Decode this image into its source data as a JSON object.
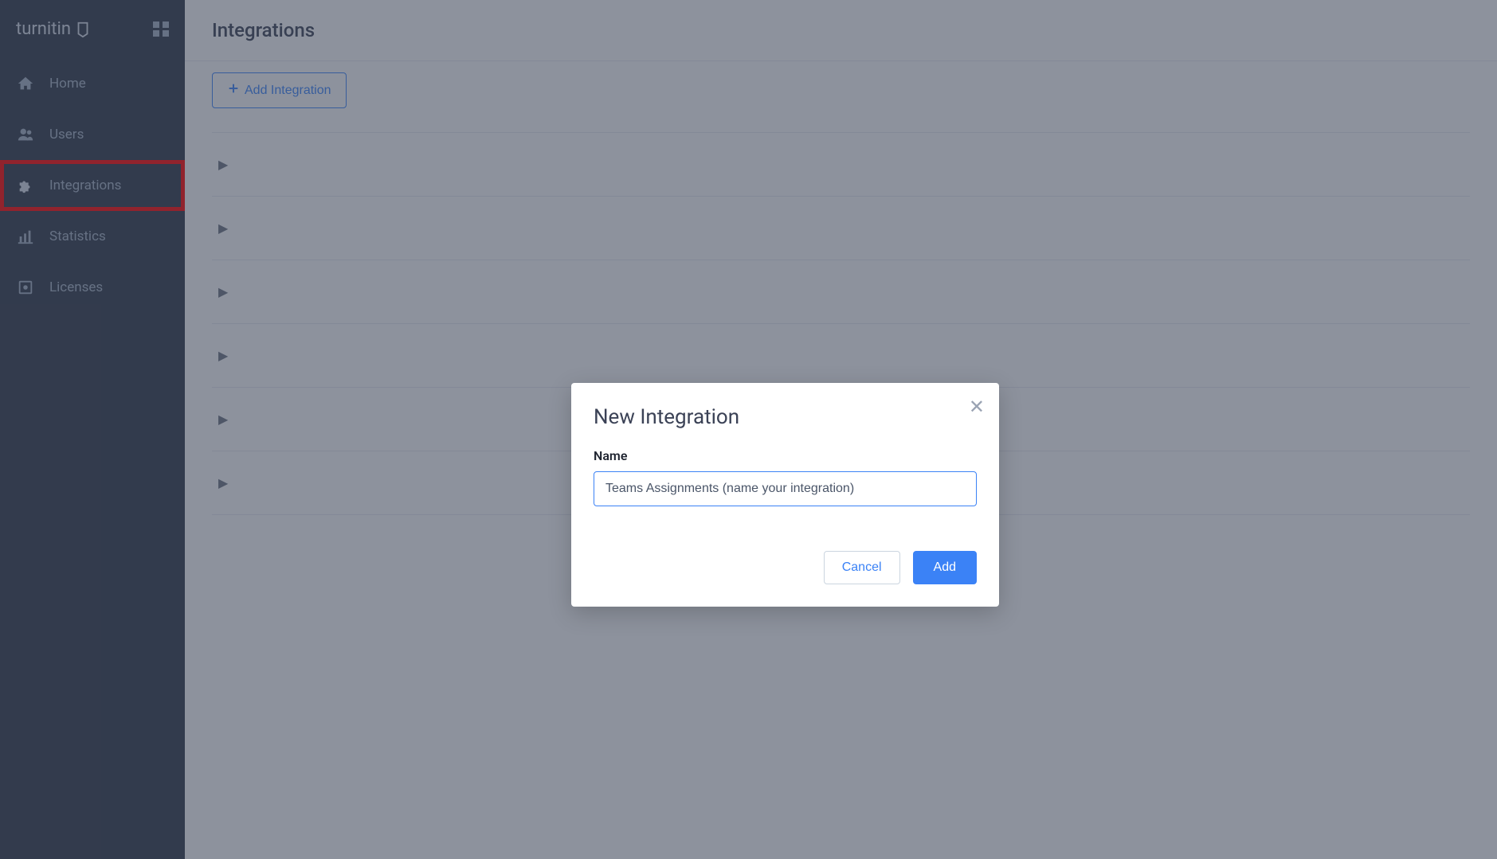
{
  "brand": {
    "name": "turnitin"
  },
  "sidebar": {
    "items": [
      {
        "label": "Home"
      },
      {
        "label": "Users"
      },
      {
        "label": "Integrations"
      },
      {
        "label": "Statistics"
      },
      {
        "label": "Licenses"
      }
    ]
  },
  "page": {
    "title": "Integrations",
    "add_button_label": "Add Integration"
  },
  "modal": {
    "title": "New Integration",
    "name_label": "Name",
    "name_value": "Teams Assignments (name your integration)",
    "cancel_label": "Cancel",
    "add_label": "Add"
  }
}
